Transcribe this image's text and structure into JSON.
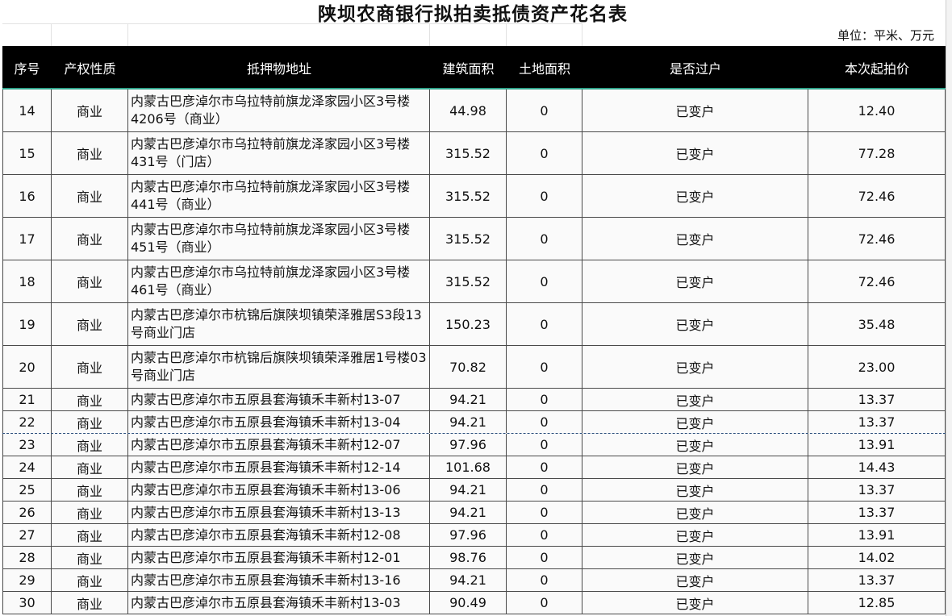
{
  "title": "陕坝农商银行拟拍卖抵债资产花名表",
  "unit": "单位：平米、万元",
  "headers": [
    "序号",
    "产权性质",
    "抵押物地址",
    "建筑面积",
    "土地面积",
    "是否过户",
    "本次起拍价"
  ],
  "rows": [
    {
      "no": "14",
      "type": "商业",
      "addr": "内蒙古巴彦淖尔市乌拉特前旗龙泽家园小区3号楼4206号（商业）",
      "area": "44.98",
      "land": "0",
      "transfer": "已变户",
      "price": "12.40",
      "tall": true
    },
    {
      "no": "15",
      "type": "商业",
      "addr": "内蒙古巴彦淖尔市乌拉特前旗龙泽家园小区3号楼431号（门店）",
      "area": "315.52",
      "land": "0",
      "transfer": "已变户",
      "price": "77.28",
      "tall": true
    },
    {
      "no": "16",
      "type": "商业",
      "addr": "内蒙古巴彦淖尔市乌拉特前旗龙泽家园小区3号楼441号（商业）",
      "area": "315.52",
      "land": "0",
      "transfer": "已变户",
      "price": "72.46",
      "tall": true
    },
    {
      "no": "17",
      "type": "商业",
      "addr": "内蒙古巴彦淖尔市乌拉特前旗龙泽家园小区3号楼451号（商业）",
      "area": "315.52",
      "land": "0",
      "transfer": "已变户",
      "price": "72.46",
      "tall": true
    },
    {
      "no": "18",
      "type": "商业",
      "addr": "内蒙古巴彦淖尔市乌拉特前旗龙泽家园小区3号楼461号（商业）",
      "area": "315.52",
      "land": "0",
      "transfer": "已变户",
      "price": "72.46",
      "tall": true
    },
    {
      "no": "19",
      "type": "商业",
      "addr": "内蒙古巴彦淖尔市杭锦后旗陕坝镇荣泽雅居S3段13号商业门店",
      "area": "150.23",
      "land": "0",
      "transfer": "已变户",
      "price": "35.48",
      "tall": true
    },
    {
      "no": "20",
      "type": "商业",
      "addr": "内蒙古巴彦淖尔市杭锦后旗陕坝镇荣泽雅居1号楼03号商业门店",
      "area": "70.82",
      "land": "0",
      "transfer": "已变户",
      "price": "23.00",
      "tall": true
    },
    {
      "no": "21",
      "type": "商业",
      "addr": "内蒙古巴彦淖尔市五原县套海镇禾丰新村13-07",
      "area": "94.21",
      "land": "0",
      "transfer": "已变户",
      "price": "13.37",
      "tall": false
    },
    {
      "no": "22",
      "type": "商业",
      "addr": "内蒙古巴彦淖尔市五原县套海镇禾丰新村13-04",
      "area": "94.21",
      "land": "0",
      "transfer": "已变户",
      "price": "13.37",
      "tall": false,
      "dash": true
    },
    {
      "no": "23",
      "type": "商业",
      "addr": "内蒙古巴彦淖尔市五原县套海镇禾丰新村12-07",
      "area": "97.96",
      "land": "0",
      "transfer": "已变户",
      "price": "13.91",
      "tall": false
    },
    {
      "no": "24",
      "type": "商业",
      "addr": "内蒙古巴彦淖尔市五原县套海镇禾丰新村12-14",
      "area": "101.68",
      "land": "0",
      "transfer": "已变户",
      "price": "14.43",
      "tall": false
    },
    {
      "no": "25",
      "type": "商业",
      "addr": "内蒙古巴彦淖尔市五原县套海镇禾丰新村13-06",
      "area": "94.21",
      "land": "0",
      "transfer": "已变户",
      "price": "13.37",
      "tall": false
    },
    {
      "no": "26",
      "type": "商业",
      "addr": "内蒙古巴彦淖尔市五原县套海镇禾丰新村13-13",
      "area": "94.21",
      "land": "0",
      "transfer": "已变户",
      "price": "13.37",
      "tall": false
    },
    {
      "no": "27",
      "type": "商业",
      "addr": "内蒙古巴彦淖尔市五原县套海镇禾丰新村12-08",
      "area": "97.96",
      "land": "0",
      "transfer": "已变户",
      "price": "13.91",
      "tall": false
    },
    {
      "no": "28",
      "type": "商业",
      "addr": "内蒙古巴彦淖尔市五原县套海镇禾丰新村12-01",
      "area": "98.76",
      "land": "0",
      "transfer": "已变户",
      "price": "14.02",
      "tall": false
    },
    {
      "no": "29",
      "type": "商业",
      "addr": "内蒙古巴彦淖尔市五原县套海镇禾丰新村13-16",
      "area": "94.21",
      "land": "0",
      "transfer": "已变户",
      "price": "13.37",
      "tall": false
    },
    {
      "no": "30",
      "type": "商业",
      "addr": "内蒙古巴彦淖尔市五原县套海镇禾丰新村13-03",
      "area": "90.49",
      "land": "0",
      "transfer": "已变户",
      "price": "12.85",
      "tall": false
    }
  ]
}
